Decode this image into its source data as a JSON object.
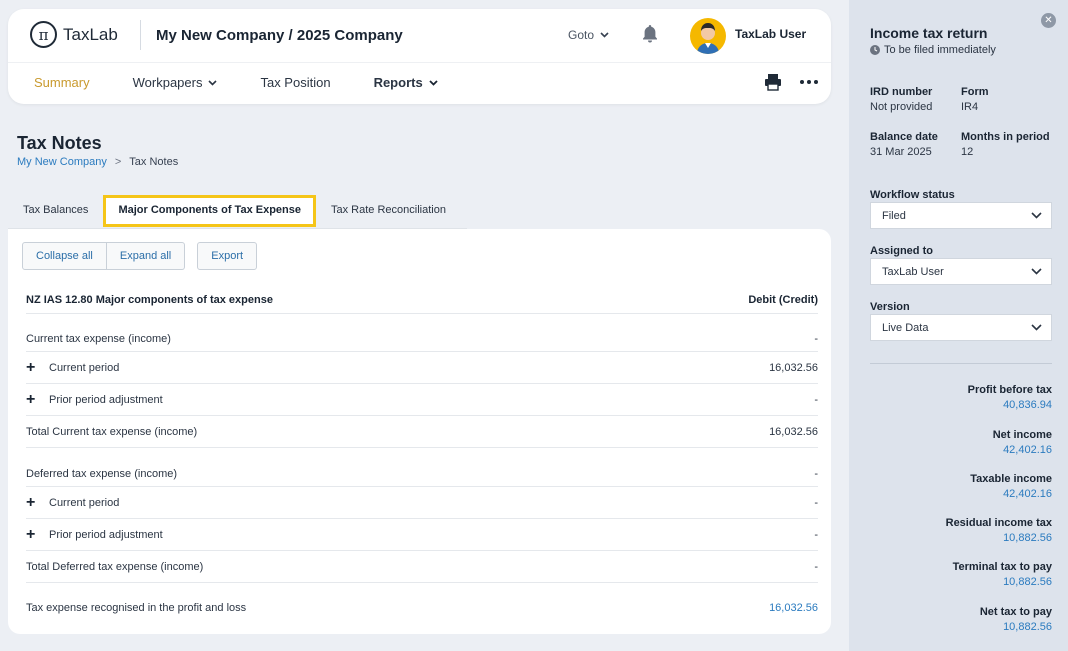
{
  "header": {
    "logo_text": "TaxLab",
    "company": "My New Company / 2025 Company",
    "goto_label": "Goto",
    "user_name": "TaxLab User"
  },
  "nav": [
    {
      "label": "Summary",
      "dropdown": false
    },
    {
      "label": "Workpapers",
      "dropdown": true
    },
    {
      "label": "Tax Position",
      "dropdown": false
    },
    {
      "label": "Reports",
      "dropdown": true
    }
  ],
  "page": {
    "title": "Tax Notes",
    "breadcrumb": [
      "My New Company",
      ">",
      "Tax Notes"
    ]
  },
  "tabs": [
    "Tax Balances",
    "Major Components of Tax Expense",
    "Tax Rate Reconciliation"
  ],
  "buttons": {
    "collapse_all": "Collapse all",
    "expand_all": "Expand all",
    "export": "Export"
  },
  "table": {
    "header": {
      "label": "NZ IAS 12.80 Major components of tax expense",
      "value": "Debit (Credit)"
    },
    "rows": [
      {
        "label": "Current tax expense (income)",
        "value": "-"
      },
      {
        "label": "Current period",
        "value": "16,032.56"
      },
      {
        "label": "Prior period adjustment",
        "value": "-"
      },
      {
        "label": "Total Current tax expense (income)",
        "value": "16,032.56"
      },
      {
        "label": "Deferred tax expense (income)",
        "value": "-"
      },
      {
        "label": "Current period",
        "value": "-"
      },
      {
        "label": "Prior period adjustment",
        "value": "-"
      },
      {
        "label": "Total Deferred tax expense (income)",
        "value": "-"
      },
      {
        "label": "Tax expense recognised in the profit and loss",
        "value": "16,032.56"
      }
    ]
  },
  "sidebar": {
    "close": "✕",
    "title": "Income tax return",
    "status": "To be filed immediately",
    "fields": {
      "ird_label": "IRD number",
      "ird_value": "Not provided",
      "form_label": "Form",
      "form_value": "IR4",
      "balance_label": "Balance date",
      "balance_value": "31 Mar 2025",
      "months_label": "Months in period",
      "months_value": "12"
    },
    "workflow_label": "Workflow status",
    "workflow_value": "Filed",
    "assigned_label": "Assigned to",
    "assigned_value": "TaxLab User",
    "version_label": "Version",
    "version_value": "Live Data",
    "metrics": [
      {
        "label": "Profit before tax",
        "value": "40,836.94"
      },
      {
        "label": "Net income",
        "value": "42,402.16"
      },
      {
        "label": "Taxable income",
        "value": "42,402.16"
      },
      {
        "label": "Residual income tax",
        "value": "10,882.56"
      },
      {
        "label": "Terminal tax to pay",
        "value": "10,882.56"
      },
      {
        "label": "Net tax to pay",
        "value": "10,882.56"
      }
    ]
  },
  "colors": {
    "accent": "#f5c518",
    "link": "#2b7bbf",
    "active_nav": "#c99a2e"
  }
}
